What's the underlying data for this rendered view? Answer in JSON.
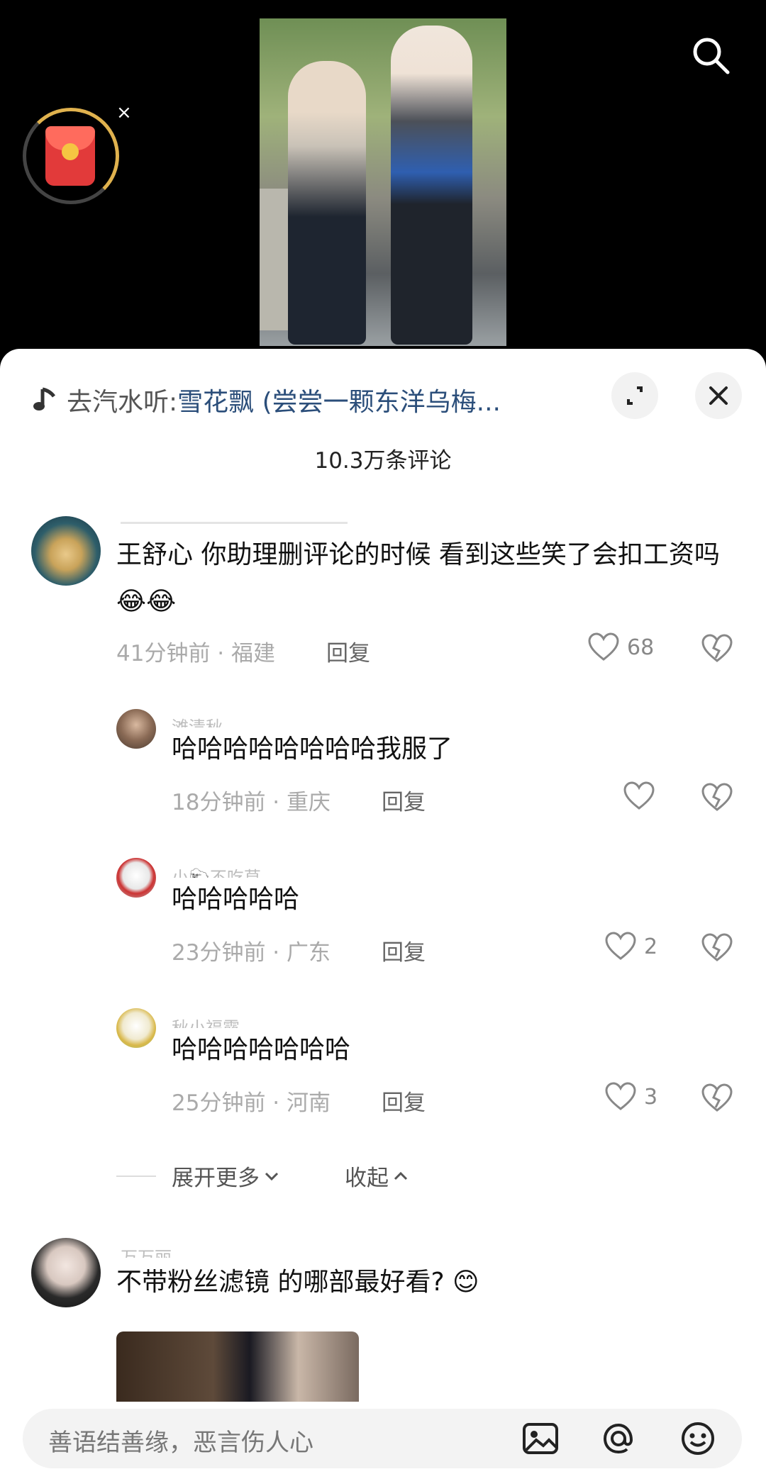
{
  "video": {
    "search_icon": "search-icon",
    "red_packet_icon": "red-packet-icon",
    "close_glyph": "×"
  },
  "header": {
    "music_prefix": "去汽水听:",
    "music_title": "雪花飘 (尝尝一颗东洋乌梅...",
    "comment_count": "10.3万条评论"
  },
  "comments": [
    {
      "text": "王舒心 你助理删评论的时候 看到这些笑了会扣工资吗😂😂",
      "meta": "41分钟前 · 福建",
      "reply_label": "回复",
      "likes": "68"
    }
  ],
  "replies": [
    {
      "username": "滩清秋",
      "text": "哈哈哈哈哈哈哈哈我服了",
      "meta": "18分钟前 · 重庆",
      "reply_label": "回复",
      "likes": ""
    },
    {
      "username": "小🐑不吃草",
      "text": "哈哈哈哈哈",
      "meta": "23分钟前 · 广东",
      "reply_label": "回复",
      "likes": "2"
    },
    {
      "username": "秋小福露",
      "text": "哈哈哈哈哈哈哈",
      "meta": "25分钟前 · 河南",
      "reply_label": "回复",
      "likes": "3"
    }
  ],
  "thread_controls": {
    "expand_more": "展开更多",
    "collapse": "收起"
  },
  "comment2": {
    "username": "万万丽",
    "text": "不带粉丝滤镜 的哪部最好看? 😊"
  },
  "input": {
    "placeholder": "善语结善缘，恶言伤人心"
  },
  "colors": {
    "link": "#2b4e7a",
    "meta": "#aaaaaa",
    "accent_gold": "#e0b24e",
    "red_packet": "#e23a3a"
  }
}
